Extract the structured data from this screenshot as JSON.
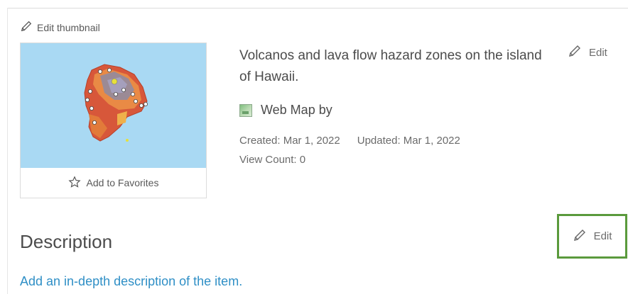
{
  "thumbnail": {
    "edit_label": "Edit thumbnail",
    "favorites_label": "Add to Favorites"
  },
  "item": {
    "title": "Volcanos and lava flow hazard zones on the island of Hawaii.",
    "edit_label": "Edit",
    "type_label": "Web Map by",
    "created": "Created: Mar 1, 2022",
    "updated": "Updated: Mar 1, 2022",
    "view_count": "View Count: 0"
  },
  "description": {
    "heading": "Description",
    "edit_label": "Edit",
    "placeholder_link": "Add an in-depth description of the item."
  },
  "icons": {
    "pencil": "pencil-icon",
    "star": "star-outline-icon",
    "webmap": "web-map-icon"
  },
  "colors": {
    "link": "#2f8fc6",
    "highlight_border": "#5a9a3c",
    "thumbnail_water": "#a6d8f2"
  }
}
